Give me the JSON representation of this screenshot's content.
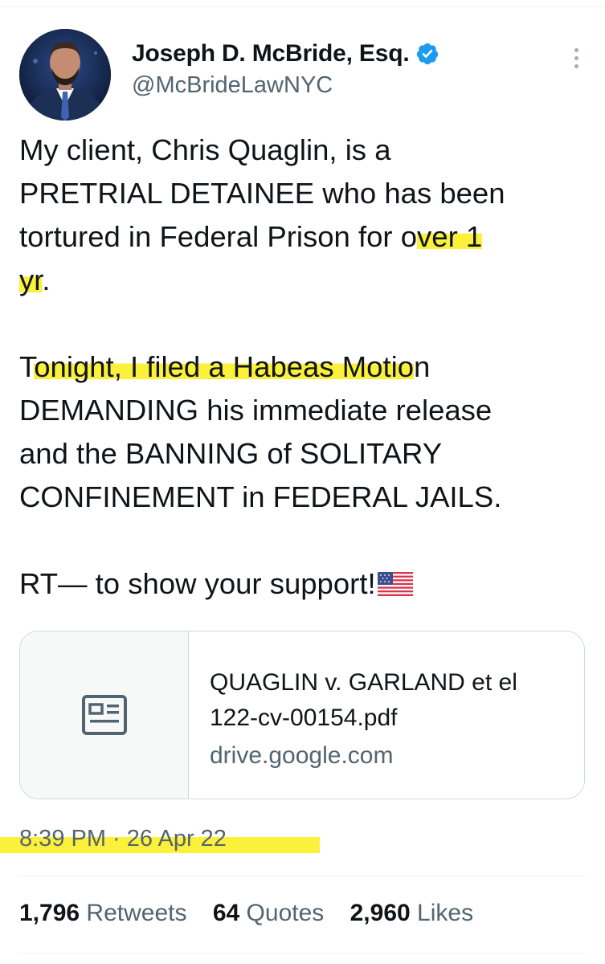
{
  "tweet": {
    "author": {
      "display_name": "Joseph D. McBride, Esq.",
      "handle": "@McBrideLawNYC",
      "verified": true
    },
    "text_lines": [
      "My client, Chris Quaglin, is a",
      "PRETRIAL DETAINEE who has been",
      "tortured in Federal Prison for over 1",
      "yr.",
      "Tonight, I filed a Habeas Motion",
      "DEMANDING his immediate release",
      "and the BANNING of SOLITARY",
      "CONFINEMENT in FEDERAL JAILS.",
      "RT— to show your support!"
    ],
    "text_fragments": {
      "l3_pre": "tortured in Federal Prison for o",
      "l3_hl": "ver 1",
      "l4_hl": "yr",
      "l4_post": ".",
      "l5_pre": "T",
      "l5_hl": "onight, I filed a Habeas Motio",
      "l5_post": "n"
    },
    "emoji": "us-flag-emoji",
    "link_card": {
      "title_line1": "QUAGLIN v. GARLAND et el",
      "title_line2": "122-cv-00154.pdf",
      "domain": "drive.google.com",
      "icon": "document-card-icon"
    },
    "timestamp": "8:39 PM · 26 Apr 22",
    "stats": {
      "retweets_count": "1,796",
      "retweets_label": "Retweets",
      "quotes_count": "64",
      "quotes_label": "Quotes",
      "likes_count": "2,960",
      "likes_label": "Likes"
    }
  },
  "colors": {
    "text_primary": "#0f1419",
    "text_secondary": "#536471",
    "verified_blue": "#1d9bf0",
    "highlight_yellow": "#fbf03a",
    "border": "#cfd9de"
  }
}
